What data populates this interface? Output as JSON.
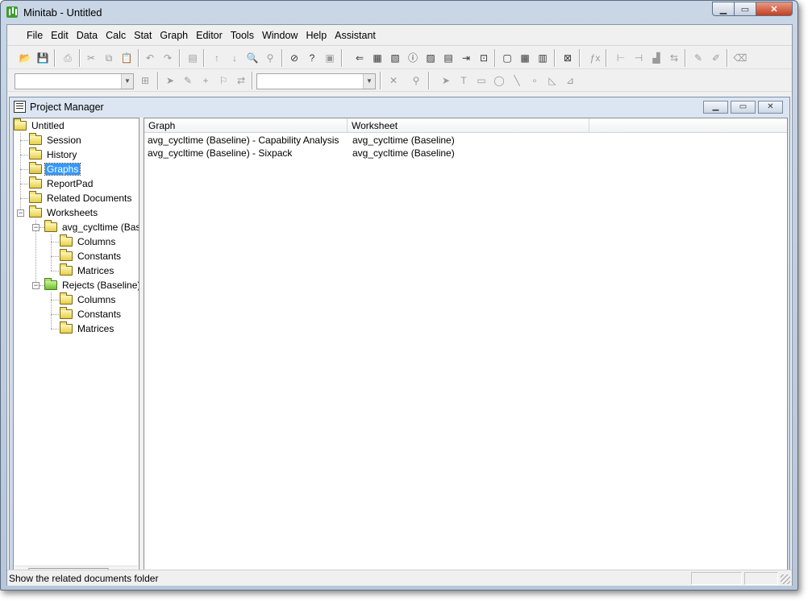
{
  "window": {
    "title": "Minitab - Untitled"
  },
  "menu": [
    "File",
    "Edit",
    "Data",
    "Calc",
    "Stat",
    "Graph",
    "Editor",
    "Tools",
    "Window",
    "Help",
    "Assistant"
  ],
  "project_manager": {
    "title": "Project Manager",
    "tree": {
      "root": "Untitled",
      "session": "Session",
      "history": "History",
      "graphs": "Graphs",
      "reportpad": "ReportPad",
      "related": "Related Documents",
      "worksheets": "Worksheets",
      "ws1": {
        "name": "avg_cycltime (Baseline)",
        "columns": "Columns",
        "constants": "Constants",
        "matrices": "Matrices"
      },
      "ws2": {
        "name": "Rejects (Baseline)",
        "columns": "Columns",
        "constants": "Constants",
        "matrices": "Matrices"
      }
    },
    "list": {
      "headers": [
        "Graph",
        "Worksheet"
      ],
      "rows": [
        {
          "graph": "avg_cycltime (Baseline) - Capability Analysis",
          "worksheet": "avg_cycltime (Baseline)"
        },
        {
          "graph": "avg_cycltime (Baseline) - Sixpack",
          "worksheet": "avg_cycltime (Baseline)"
        }
      ]
    }
  },
  "status": {
    "text": "Show the related documents folder"
  },
  "colors": {
    "selection": "#3399ff",
    "folder": "#e6cf48",
    "folder_green": "#6cbf2f"
  }
}
